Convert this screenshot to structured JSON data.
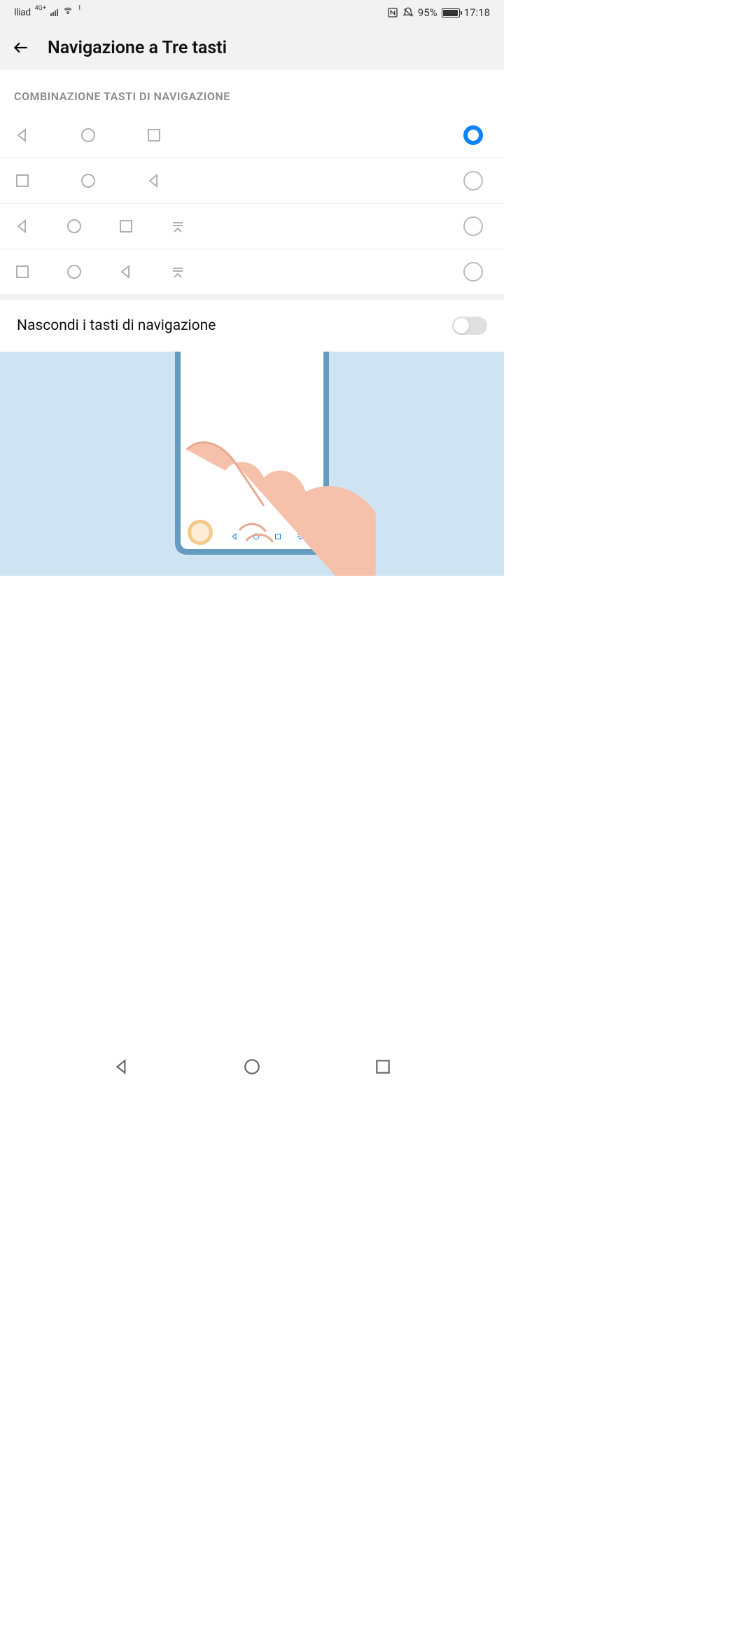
{
  "status_bar": {
    "carrier": "Iliad",
    "network_badge": "4G+",
    "sup_badge": "1",
    "battery_pct": "95%",
    "time": "17:18"
  },
  "header": {
    "title": "Navigazione a Tre tasti"
  },
  "section": {
    "combo_label": "COMBINAZIONE TASTI DI NAVIGAZIONE"
  },
  "options": [
    {
      "keys": [
        "back",
        "home",
        "recent"
      ],
      "selected": true
    },
    {
      "keys": [
        "recent",
        "home",
        "back"
      ],
      "selected": false
    },
    {
      "keys": [
        "back",
        "home",
        "recent",
        "dropdown"
      ],
      "selected": false
    },
    {
      "keys": [
        "recent",
        "home",
        "back",
        "dropdown"
      ],
      "selected": false
    }
  ],
  "hide_nav": {
    "label": "Nascondi i tasti di navigazione",
    "enabled": false
  },
  "icons": {
    "back": "back-triangle-icon",
    "home": "home-circle-icon",
    "recent": "recent-square-icon",
    "dropdown": "dropdown-icon"
  }
}
